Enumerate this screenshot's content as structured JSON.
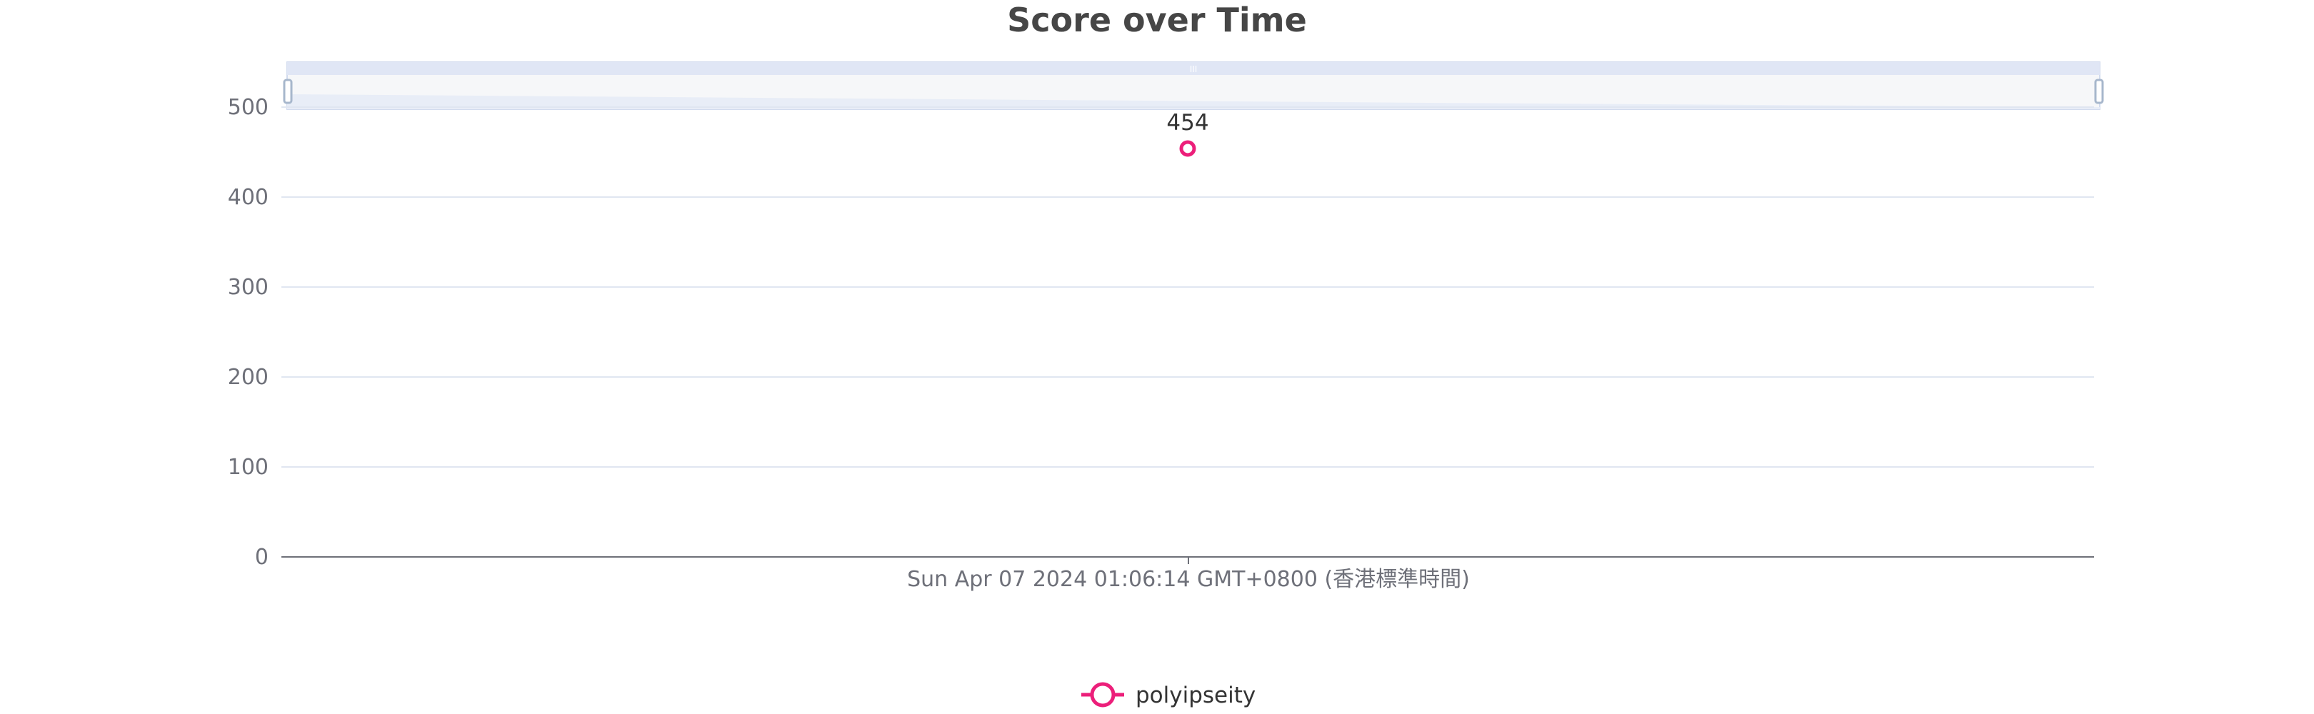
{
  "chart_data": {
    "type": "line",
    "title": "Score over Time",
    "xlabel": "",
    "ylabel": "",
    "ylim": [
      0,
      500
    ],
    "y_ticks": [
      0,
      100,
      200,
      300,
      400,
      500
    ],
    "x": [
      "Sun Apr 07 2024 01:06:14 GMT+0800 (香港標準時間)"
    ],
    "series": [
      {
        "name": "polyipseity",
        "values": [
          454
        ],
        "labels": [
          "454"
        ]
      }
    ],
    "grid": true,
    "legend_position": "bottom-center",
    "data_zoom": "top",
    "data_zoom_handle_glyph": "III"
  },
  "colors": {
    "series": "#ec1f7a",
    "grid": "#e0e6f1",
    "axis": "#6e7079",
    "title": "#464646",
    "label": "#333333",
    "zoom_fill": "#e0e6f5",
    "zoom_border": "#d2dbee",
    "zoom_handle": "#a7b7cc"
  }
}
